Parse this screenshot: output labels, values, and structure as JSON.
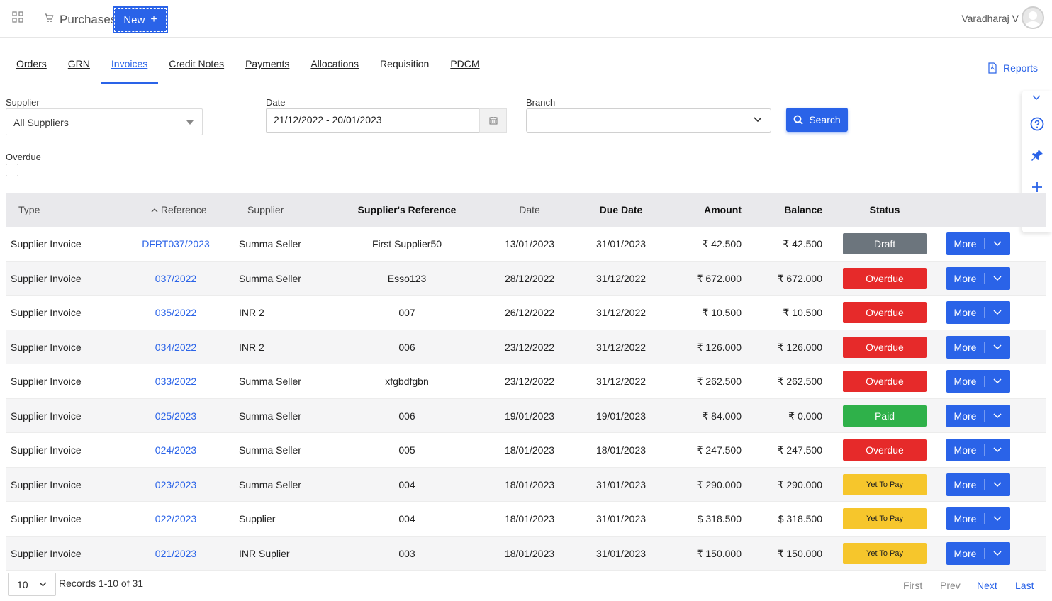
{
  "header": {
    "app_title": "Purchases",
    "new_label": "New",
    "user_name": "Varadharaj V"
  },
  "tabs": [
    {
      "label": "Orders",
      "active": false
    },
    {
      "label": "GRN",
      "active": false
    },
    {
      "label": "Invoices",
      "active": true
    },
    {
      "label": "Credit Notes",
      "active": false
    },
    {
      "label": "Payments",
      "active": false
    },
    {
      "label": "Allocations",
      "active": false
    },
    {
      "label": "Requisition",
      "active": false
    },
    {
      "label": "PDCM",
      "active": false
    }
  ],
  "reports_label": "Reports",
  "filters": {
    "supplier_label": "Supplier",
    "supplier_value": "All Suppliers",
    "date_label": "Date",
    "date_value": "21/12/2022 - 20/01/2023",
    "branch_label": "Branch",
    "branch_value": "",
    "search_label": "Search",
    "overdue_label": "Overdue"
  },
  "table": {
    "columns": [
      "Type",
      "Reference",
      "Supplier",
      "Supplier's Reference",
      "Date",
      "Due Date",
      "Amount",
      "Balance",
      "Status"
    ],
    "more_label": "More",
    "rows": [
      {
        "type": "Supplier Invoice",
        "ref": "DFRT037/2023",
        "supplier": "Summa Seller",
        "sref": "First Supplier50",
        "date": "13/01/2023",
        "due": "31/01/2023",
        "amount": "₹ 42.500",
        "balance": "₹ 42.500",
        "status": "Draft"
      },
      {
        "type": "Supplier Invoice",
        "ref": "037/2022",
        "supplier": "Summa Seller",
        "sref": "Esso123",
        "date": "28/12/2022",
        "due": "31/12/2022",
        "amount": "₹ 672.000",
        "balance": "₹ 672.000",
        "status": "Overdue"
      },
      {
        "type": "Supplier Invoice",
        "ref": "035/2022",
        "supplier": "INR 2",
        "sref": "007",
        "date": "26/12/2022",
        "due": "31/12/2022",
        "amount": "₹ 10.500",
        "balance": "₹ 10.500",
        "status": "Overdue"
      },
      {
        "type": "Supplier Invoice",
        "ref": "034/2022",
        "supplier": "INR 2",
        "sref": "006",
        "date": "23/12/2022",
        "due": "31/12/2022",
        "amount": "₹ 126.000",
        "balance": "₹ 126.000",
        "status": "Overdue"
      },
      {
        "type": "Supplier Invoice",
        "ref": "033/2022",
        "supplier": "Summa Seller",
        "sref": "xfgbdfgbn",
        "date": "23/12/2022",
        "due": "31/12/2022",
        "amount": "₹ 262.500",
        "balance": "₹ 262.500",
        "status": "Overdue"
      },
      {
        "type": "Supplier Invoice",
        "ref": "025/2023",
        "supplier": "Summa Seller",
        "sref": "006",
        "date": "19/01/2023",
        "due": "19/01/2023",
        "amount": "₹ 84.000",
        "balance": "₹ 0.000",
        "status": "Paid"
      },
      {
        "type": "Supplier Invoice",
        "ref": "024/2023",
        "supplier": "Summa Seller",
        "sref": "005",
        "date": "18/01/2023",
        "due": "18/01/2023",
        "amount": "₹ 247.500",
        "balance": "₹ 247.500",
        "status": "Overdue"
      },
      {
        "type": "Supplier Invoice",
        "ref": "023/2023",
        "supplier": "Summa Seller",
        "sref": "004",
        "date": "18/01/2023",
        "due": "31/01/2023",
        "amount": "₹ 290.000",
        "balance": "₹ 290.000",
        "status": "Yet To Pay"
      },
      {
        "type": "Supplier Invoice",
        "ref": "022/2023",
        "supplier": "Supplier",
        "sref": "004",
        "date": "18/01/2023",
        "due": "31/01/2023",
        "amount": "$ 318.500",
        "balance": "$ 318.500",
        "status": "Yet To Pay"
      },
      {
        "type": "Supplier Invoice",
        "ref": "021/2023",
        "supplier": "INR Suplier",
        "sref": "003",
        "date": "18/01/2023",
        "due": "31/01/2023",
        "amount": "₹ 150.000",
        "balance": "₹ 150.000",
        "status": "Yet To Pay"
      }
    ]
  },
  "status_colors": {
    "Draft": "#6c757d",
    "Overdue": "#e62a2a",
    "Paid": "#2fb14a",
    "Yet To Pay": "#f6c62c"
  },
  "footer": {
    "per_page": "10",
    "records": "Records 1-10 of 31",
    "first": "First",
    "prev": "Prev",
    "next": "Next",
    "last": "Last"
  },
  "colors": {
    "accent": "#2a63e8"
  },
  "side_icons": [
    "chevron-down-icon",
    "help-icon",
    "pin-icon",
    "plus-icon",
    "book-icon"
  ]
}
